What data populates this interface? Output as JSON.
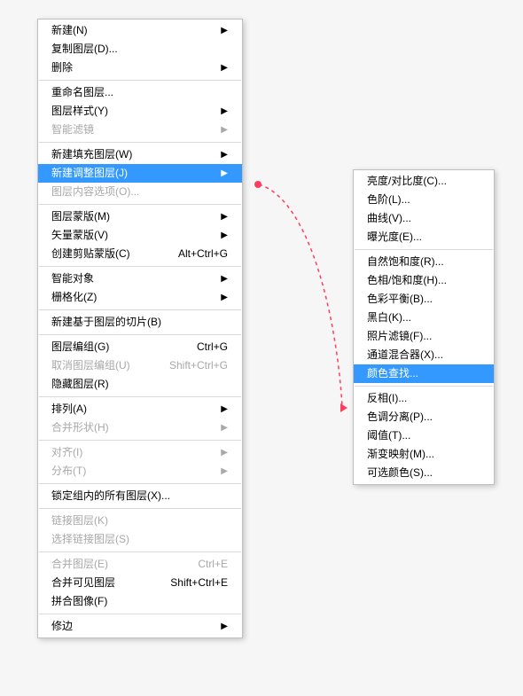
{
  "main_menu": {
    "groups": [
      [
        {
          "label": "新建(N)",
          "arrow": true
        },
        {
          "label": "复制图层(D)..."
        },
        {
          "label": "删除",
          "arrow": true
        }
      ],
      [
        {
          "label": "重命名图层..."
        },
        {
          "label": "图层样式(Y)",
          "arrow": true
        },
        {
          "label": "智能滤镜",
          "arrow": true,
          "disabled": true
        }
      ],
      [
        {
          "label": "新建填充图层(W)",
          "arrow": true
        },
        {
          "label": "新建调整图层(J)",
          "arrow": true,
          "selected": true
        },
        {
          "label": "图层内容选项(O)...",
          "disabled": true
        }
      ],
      [
        {
          "label": "图层蒙版(M)",
          "arrow": true
        },
        {
          "label": "矢量蒙版(V)",
          "arrow": true
        },
        {
          "label": "创建剪贴蒙版(C)",
          "shortcut": "Alt+Ctrl+G"
        }
      ],
      [
        {
          "label": "智能对象",
          "arrow": true
        },
        {
          "label": "栅格化(Z)",
          "arrow": true
        }
      ],
      [
        {
          "label": "新建基于图层的切片(B)"
        }
      ],
      [
        {
          "label": "图层编组(G)",
          "shortcut": "Ctrl+G"
        },
        {
          "label": "取消图层编组(U)",
          "shortcut": "Shift+Ctrl+G",
          "disabled": true
        },
        {
          "label": "隐藏图层(R)"
        }
      ],
      [
        {
          "label": "排列(A)",
          "arrow": true
        },
        {
          "label": "合并形状(H)",
          "arrow": true,
          "disabled": true
        }
      ],
      [
        {
          "label": "对齐(I)",
          "arrow": true,
          "disabled": true
        },
        {
          "label": "分布(T)",
          "arrow": true,
          "disabled": true
        }
      ],
      [
        {
          "label": "锁定组内的所有图层(X)..."
        }
      ],
      [
        {
          "label": "链接图层(K)",
          "disabled": true
        },
        {
          "label": "选择链接图层(S)",
          "disabled": true
        }
      ],
      [
        {
          "label": "合并图层(E)",
          "shortcut": "Ctrl+E",
          "disabled": true
        },
        {
          "label": "合并可见图层",
          "shortcut": "Shift+Ctrl+E"
        },
        {
          "label": "拼合图像(F)"
        }
      ],
      [
        {
          "label": "修边",
          "arrow": true
        }
      ]
    ]
  },
  "sub_menu": {
    "groups": [
      [
        {
          "label": "亮度/对比度(C)..."
        },
        {
          "label": "色阶(L)..."
        },
        {
          "label": "曲线(V)..."
        },
        {
          "label": "曝光度(E)..."
        }
      ],
      [
        {
          "label": "自然饱和度(R)..."
        },
        {
          "label": "色相/饱和度(H)..."
        },
        {
          "label": "色彩平衡(B)..."
        },
        {
          "label": "黑白(K)..."
        },
        {
          "label": "照片滤镜(F)..."
        },
        {
          "label": "通道混合器(X)..."
        },
        {
          "label": "颜色查找...",
          "selected": true
        }
      ],
      [
        {
          "label": "反相(I)..."
        },
        {
          "label": "色调分离(P)..."
        },
        {
          "label": "阈值(T)..."
        },
        {
          "label": "渐变映射(M)..."
        },
        {
          "label": "可选颜色(S)..."
        }
      ]
    ]
  },
  "arrow_char": "▶"
}
